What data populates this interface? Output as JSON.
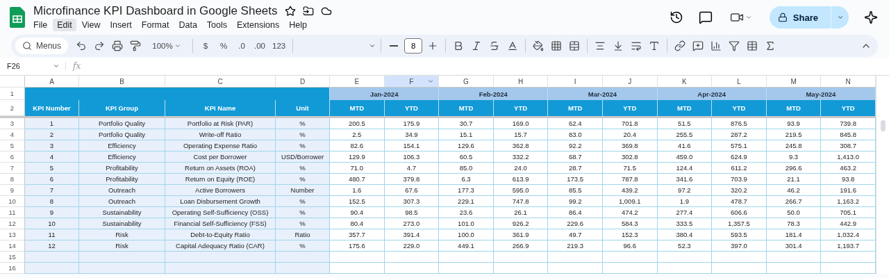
{
  "document": {
    "title": "Microfinance KPI Dashboard in Google Sheets",
    "share_label": "Share"
  },
  "menus": [
    {
      "label": "File",
      "active": false
    },
    {
      "label": "Edit",
      "active": true
    },
    {
      "label": "View",
      "active": false
    },
    {
      "label": "Insert",
      "active": false
    },
    {
      "label": "Format",
      "active": false
    },
    {
      "label": "Data",
      "active": false
    },
    {
      "label": "Tools",
      "active": false
    },
    {
      "label": "Extensions",
      "active": false
    },
    {
      "label": "Help",
      "active": false
    }
  ],
  "toolbar": {
    "search_placeholder": "Menus",
    "zoom": "100%",
    "currency": "$",
    "percent": "%",
    "decrease_decimals": ".0",
    "increase_decimals": ".00",
    "number_format": "123",
    "font_size": "8"
  },
  "formula_bar": {
    "cell_ref": "F26",
    "fx": "fx"
  },
  "columns": [
    {
      "letter": "A",
      "selected": false
    },
    {
      "letter": "B",
      "selected": false
    },
    {
      "letter": "C",
      "selected": false
    },
    {
      "letter": "D",
      "selected": false
    },
    {
      "letter": "E",
      "selected": false
    },
    {
      "letter": "F",
      "selected": true
    },
    {
      "letter": "G",
      "selected": false
    },
    {
      "letter": "H",
      "selected": false
    },
    {
      "letter": "I",
      "selected": false
    },
    {
      "letter": "J",
      "selected": false
    },
    {
      "letter": "K",
      "selected": false
    },
    {
      "letter": "L",
      "selected": false
    },
    {
      "letter": "M",
      "selected": false
    },
    {
      "letter": "N",
      "selected": false
    }
  ],
  "row_numbers": [
    "1",
    "2",
    "3",
    "4",
    "5",
    "6",
    "7",
    "8",
    "9",
    "10",
    "11",
    "12",
    "13",
    "14",
    "15",
    "16"
  ],
  "months": [
    "Jan-2024",
    "Feb-2024",
    "Mar-2024",
    "Apr-2024",
    "May-2024"
  ],
  "kpi_headers": [
    "KPI Number",
    "KPI Group",
    "KPI Name",
    "Unit"
  ],
  "period_headers": [
    "MTD",
    "YTD",
    "MTD",
    "YTD",
    "MTD",
    "YTD",
    "MTD",
    "YTD",
    "MTD",
    "YTD"
  ],
  "rows": [
    [
      "1",
      "Portfolio Quality",
      "Portfolio at Risk (PAR)",
      "%",
      "200.5",
      "175.9",
      "30.7",
      "169.0",
      "62.4",
      "701.8",
      "51.5",
      "876.5",
      "93.9",
      "739.8"
    ],
    [
      "2",
      "Portfolio Quality",
      "Write-off Ratio",
      "%",
      "2.5",
      "34.9",
      "15.1",
      "15.7",
      "83.0",
      "20.4",
      "255.5",
      "287.2",
      "219.5",
      "845.8"
    ],
    [
      "3",
      "Efficiency",
      "Operating Expense Ratio",
      "%",
      "82.6",
      "154.1",
      "129.6",
      "362.8",
      "92.2",
      "369.8",
      "41.6",
      "575.1",
      "245.8",
      "308.7"
    ],
    [
      "4",
      "Efficiency",
      "Cost per Borrower",
      "USD/Borrower",
      "129.9",
      "106.3",
      "60.5",
      "332.2",
      "68.7",
      "302.8",
      "459.0",
      "624.9",
      "9.3",
      "1,413.0"
    ],
    [
      "5",
      "Profitability",
      "Return on Assets (ROA)",
      "%",
      "71.0",
      "4.7",
      "85.0",
      "24.0",
      "28.7",
      "71.5",
      "124.4",
      "611.2",
      "296.6",
      "463.2"
    ],
    [
      "6",
      "Profitability",
      "Return on Equity (ROE)",
      "%",
      "480.7",
      "379.8",
      "6.3",
      "613.9",
      "173.5",
      "787.8",
      "341.6",
      "703.9",
      "21.1",
      "93.8"
    ],
    [
      "7",
      "Outreach",
      "Active Borrowers",
      "Number",
      "1.6",
      "67.6",
      "177.3",
      "595.0",
      "85.5",
      "439.2",
      "97.2",
      "320.2",
      "46.2",
      "191.6"
    ],
    [
      "8",
      "Outreach",
      "Loan Disbursement Growth",
      "%",
      "152.5",
      "307.3",
      "229.1",
      "747.8",
      "99.2",
      "1,009.1",
      "1.9",
      "478.7",
      "266.7",
      "1,163.2"
    ],
    [
      "9",
      "Sustainability",
      "Operating Self-Sufficiency (OSS)",
      "%",
      "90.4",
      "98.5",
      "23.6",
      "26.1",
      "86.4",
      "474.2",
      "277.4",
      "606.6",
      "50.0",
      "705.1"
    ],
    [
      "10",
      "Sustainability",
      "Financial Self-Sufficiency (FSS)",
      "%",
      "80.4",
      "273.0",
      "101.0",
      "926.2",
      "229.6",
      "584.3",
      "333.5",
      "1,357.5",
      "78.3",
      "442.9"
    ],
    [
      "11",
      "Risk",
      "Debt-to-Equity Ratio",
      "Ratio",
      "357.7",
      "391.4",
      "100.0",
      "361.9",
      "49.7",
      "152.3",
      "380.4",
      "593.5",
      "181.4",
      "1,032.4"
    ],
    [
      "12",
      "Risk",
      "Capital Adequacy Ratio (CAR)",
      "%",
      "175.6",
      "229.0",
      "449.1",
      "266.9",
      "219.3",
      "96.6",
      "52.3",
      "397.0",
      "301.4",
      "1,193.7"
    ]
  ]
}
